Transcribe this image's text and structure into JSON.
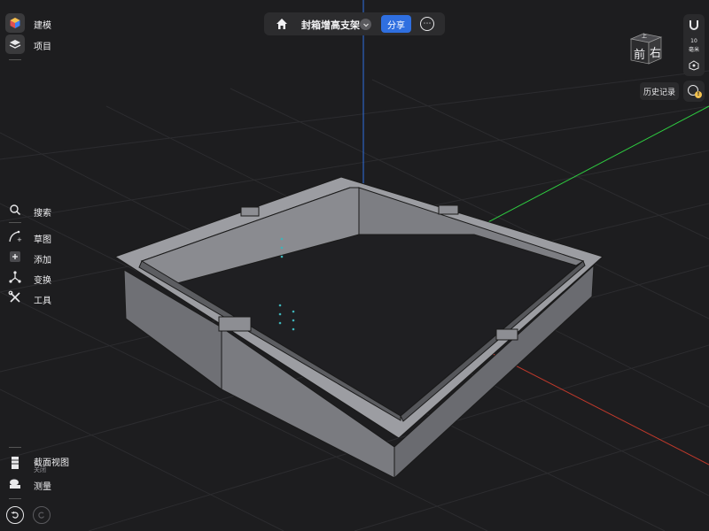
{
  "header": {
    "title": "封箱增高支架",
    "share_label": "分享",
    "home_icon": "home-icon",
    "dropdown_icon": "chevron-down-icon",
    "more_icon": "more-icon"
  },
  "left_toolbar": {
    "top": [
      {
        "id": "build",
        "label": "建模",
        "icon": "model-icon"
      },
      {
        "id": "project",
        "label": "项目",
        "icon": "layers-icon"
      }
    ],
    "middle": [
      {
        "id": "search",
        "label": "搜索",
        "icon": "search-icon"
      },
      {
        "id": "sketch",
        "label": "草图",
        "icon": "sketch-icon"
      },
      {
        "id": "add",
        "label": "添加",
        "icon": "add-icon"
      },
      {
        "id": "transform",
        "label": "变换",
        "icon": "transform-icon"
      },
      {
        "id": "tools",
        "label": "工具",
        "icon": "tools-icon"
      }
    ],
    "bottom": [
      {
        "id": "section",
        "label": "截面视图",
        "sublabel": "关闭",
        "icon": "section-view-icon"
      },
      {
        "id": "measure",
        "label": "测量",
        "icon": "measure-icon"
      }
    ]
  },
  "right_toolbar": {
    "units_value": "10",
    "units_label": "毫米",
    "view_cube": {
      "front": "前",
      "right": "右",
      "top": "上"
    },
    "history_label": "历史记录",
    "history_badge": "!"
  },
  "colors": {
    "background": "#1d1d1f",
    "accent": "#2f6fe0",
    "axis_x": "#c0392b",
    "axis_y": "#2ecc40",
    "axis_z": "#2f6fe0",
    "model": "#8e8f94"
  }
}
